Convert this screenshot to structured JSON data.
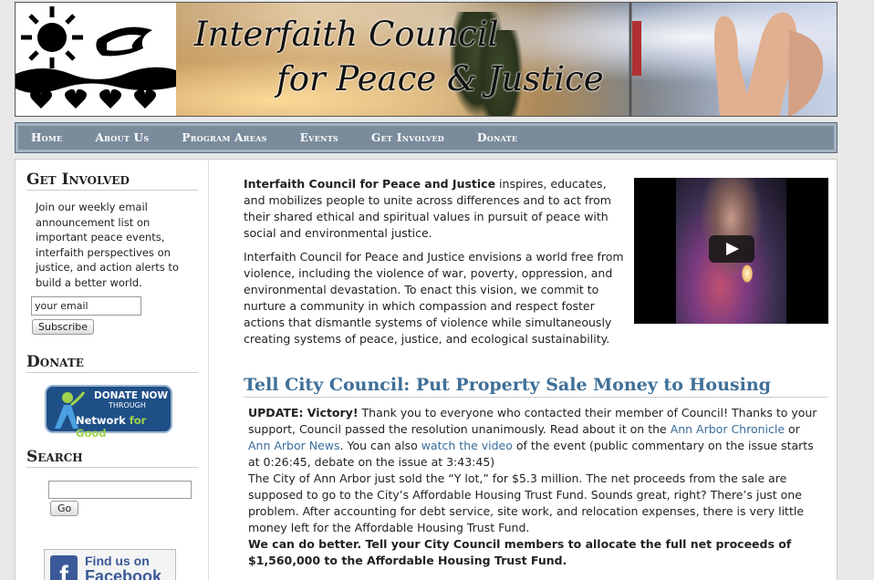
{
  "header": {
    "title_line1": "Interfaith Council",
    "title_line2": "for Peace & Justice"
  },
  "nav": {
    "items": [
      "Home",
      "About Us",
      "Program Areas",
      "Events",
      "Get Involved",
      "Donate"
    ]
  },
  "sidebar": {
    "get_involved_heading": "Get Involved",
    "get_involved_text": "Join our weekly email announcement list on important peace events, interfaith perspectives on justice, and action alerts to build a better world.",
    "email_value": "your email",
    "subscribe_label": "Subscribe",
    "donate_heading": "Donate",
    "donate_badge": {
      "line1": "DONATE NOW",
      "line2": "THROUGH",
      "line3a": "Network",
      "line3b": " for Good"
    },
    "search_heading": "Search",
    "search_button": "Go",
    "facebook": {
      "line1": "Find us on",
      "line2": "Facebook"
    }
  },
  "content": {
    "intro_strong": "Interfaith Council for Peace and Justice",
    "intro_rest": " inspires, educates, and mobilizes people to unite across differences and to act from their shared ethical and spiritual values in pursuit of peace with social and environmental justice.",
    "intro_p2": "Interfaith Council for Peace and Justice envisions a world free from violence, including the violence of war, poverty, oppression, and environmental devastation. To enact this vision, we commit to nurture a community in which compassion and respect foster actions that dismantle systems of violence while simultaneously creating systems of peace, justice, and ecological sustainability.",
    "post": {
      "title": "Tell City Council: Put Property Sale Money to Housing",
      "update_label": "UPDATE: Victory!",
      "update_text1": " Thank you to everyone who contacted their member of Council! Thanks to your support, Council passed the resolution unanimously. Read about it on the ",
      "link_chronicle": "Ann Arbor Chronicle",
      "or": " or ",
      "link_news": "Ann Arbor News",
      "update_text2": ". You can also ",
      "link_video": "watch the video",
      "update_text3": " of the event (public commentary on the issue starts at 0:26:45, debate on the issue at 3:43:45)",
      "para2": "The City of Ann Arbor just sold the “Y lot,” for $5.3 million. The net proceeds from the sale are supposed to go to the City’s Affordable Housing Trust Fund. Sounds great, right? There’s just one problem. After accounting for debt service, site work, and relocation expenses, there is very little money left for the Affordable Housing Trust Fund.",
      "para3_start": "We can do better. ",
      "para3_strong": "Tell your City Council members to allocate the full net proceeds of $1,560,000 to the Affordable Housing Trust Fund."
    }
  }
}
